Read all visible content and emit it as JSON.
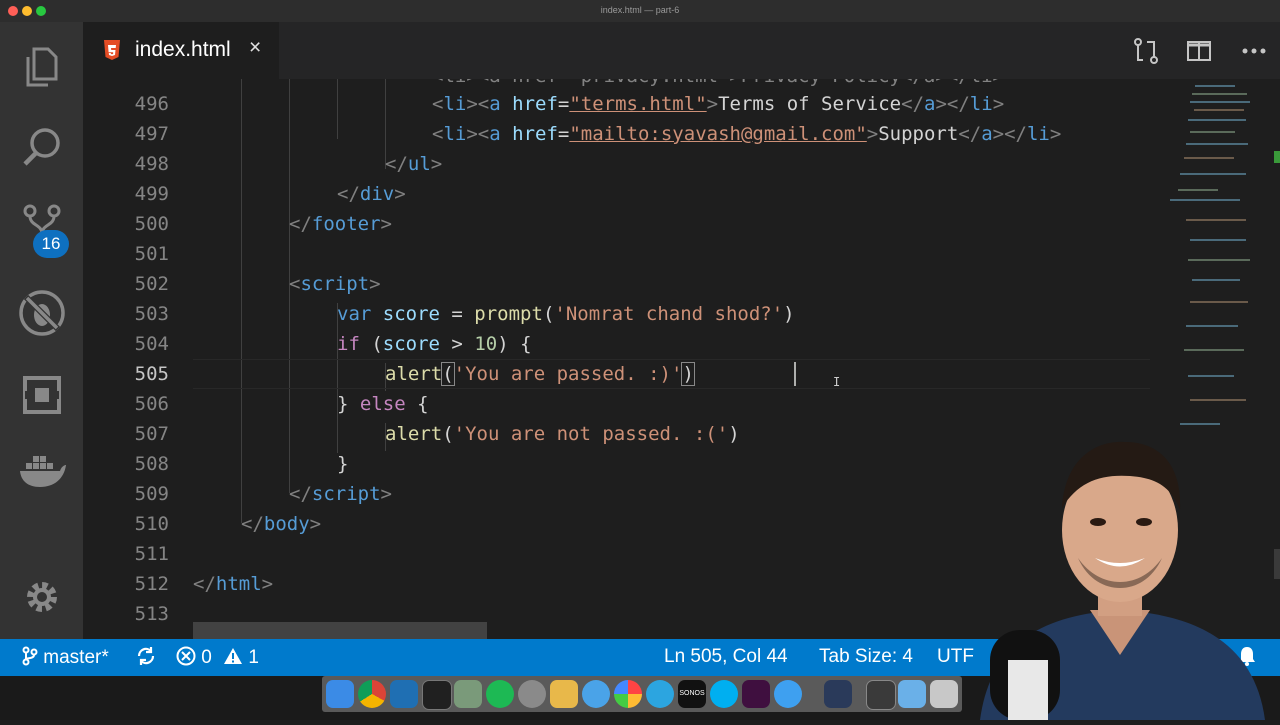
{
  "window": {
    "title": "index.html — part-6"
  },
  "activity": {
    "scm_badge": "16"
  },
  "tab": {
    "label": "index.html",
    "close": "×",
    "icon": "html5-icon"
  },
  "editor": {
    "active_line": "505",
    "partial_top_line": "<li><a href=\"privacy.html\">Privacy Policy</a></li>",
    "line_numbers": [
      "496",
      "497",
      "498",
      "499",
      "500",
      "501",
      "502",
      "503",
      "504",
      "505",
      "506",
      "507",
      "508",
      "509",
      "510",
      "511",
      "512",
      "513"
    ],
    "code": {
      "l496": {
        "a": "<",
        "b": "li",
        "c": "><",
        "d": "a",
        "e": " ",
        "f": "href",
        "g": "=",
        "h": "\"terms.html\"",
        "i": ">",
        "j": "Terms of Service",
        "k": "</",
        "l": "a",
        "m": "></",
        "n": "li",
        "o": ">"
      },
      "l497": {
        "a": "<",
        "b": "li",
        "c": "><",
        "d": "a",
        "e": " ",
        "f": "href",
        "g": "=",
        "h": "\"mailto:syavash@gmail.com\"",
        "i": ">",
        "j": "Support",
        "k": "</",
        "l": "a",
        "m": "></",
        "n": "li",
        "o": ">"
      },
      "l498": {
        "a": "</",
        "b": "ul",
        "c": ">"
      },
      "l499": {
        "a": "</",
        "b": "div",
        "c": ">"
      },
      "l500": {
        "a": "</",
        "b": "footer",
        "c": ">"
      },
      "l502": {
        "a": "<",
        "b": "script",
        "c": ">"
      },
      "l503": {
        "kw": "var",
        "v": " score",
        "op": " = ",
        "fn": "prompt",
        "p1": "(",
        "s": "'Nomrat chand shod?'",
        "p2": ")"
      },
      "l504": {
        "kw": "if",
        "p1": " (",
        "v": "score",
        "op": " > ",
        "n": "10",
        "p2": ") {"
      },
      "l505": {
        "fn": "alert",
        "p1": "(",
        "s": "'You are passed. :)'",
        "p2": ")"
      },
      "l506": {
        "p1": "} ",
        "kw": "else",
        "p2": " {"
      },
      "l507": {
        "fn": "alert",
        "p1": "(",
        "s": "'You are not passed. :('",
        "p2": ")"
      },
      "l508": {
        "p": "}"
      },
      "l509": {
        "a": "</",
        "b": "script",
        "c": ">"
      },
      "l510": {
        "a": "</",
        "b": "body",
        "c": ">"
      },
      "l512": {
        "a": "</",
        "b": "html",
        "c": ">"
      }
    }
  },
  "statusbar": {
    "branch": "master*",
    "errors": "0",
    "warnings": "1",
    "position": "Ln 505, Col 44",
    "tab_size": "Tab Size: 4",
    "encoding": "UTF"
  },
  "dock": {
    "apps": [
      "finder-icon",
      "chrome-icon",
      "vscode-icon",
      "terminal-icon",
      "transmit-icon",
      "spotify-icon",
      "system-preferences-icon",
      "sequel-icon",
      "safari-icon",
      "photos-icon",
      "telegram-icon",
      "sonos-icon",
      "skype-icon",
      "slack-icon",
      "messages-icon",
      "tweetdeck-icon",
      "sublime-icon",
      "folder-icon",
      "trash-icon"
    ],
    "sonos_label": "SONOS"
  },
  "colors": {
    "statusbar": "#007acc",
    "activitybar": "#333333",
    "editor_bg": "#1e1e1e",
    "badge": "#0e70c0"
  }
}
